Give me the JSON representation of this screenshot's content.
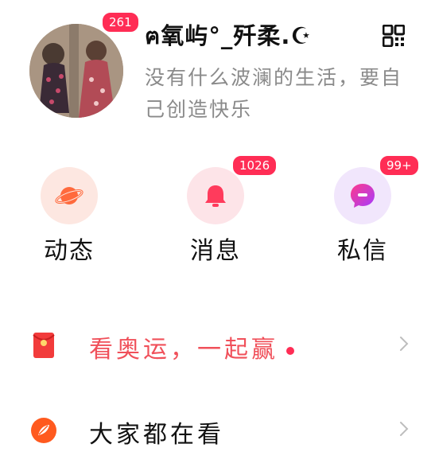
{
  "profile": {
    "avatar_badge": "261",
    "username": "ฅ氧屿°_歼柔.☪",
    "bio": "没有什么波澜的生活，要自己创造快乐"
  },
  "actions": [
    {
      "label": "动态",
      "icon": "planet-icon",
      "badge": ""
    },
    {
      "label": "消息",
      "icon": "bell-icon",
      "badge": "1026"
    },
    {
      "label": "私信",
      "icon": "chat-bubble-icon",
      "badge": "99+"
    }
  ],
  "list": {
    "fortune": {
      "label": "看奥运，一起赢",
      "icon": "red-envelope-icon"
    },
    "everyone": {
      "label": "大家都在看",
      "icon": "compass-leaf-icon"
    }
  },
  "colors": {
    "badge": "#ff2d55",
    "fortune_text": "#f0505a",
    "bio_text": "#8a8a8a"
  }
}
